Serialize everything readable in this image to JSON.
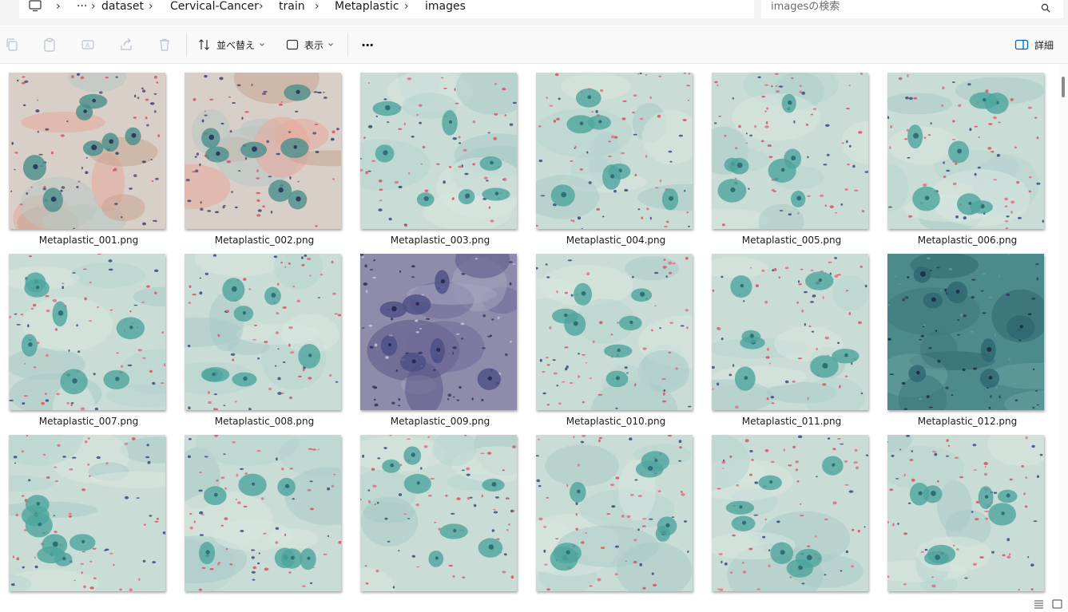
{
  "breadcrumb": {
    "items": [
      "dataset",
      "Cervical-Cancer",
      "train",
      "Metaplastic",
      "images"
    ],
    "overflow": "···"
  },
  "search": {
    "placeholder": "imagesの検索"
  },
  "toolbar": {
    "sort_label": "並べ替え",
    "view_label": "表示",
    "more": "···",
    "details_label": "詳細"
  },
  "files": [
    {
      "name": "Metaplastic_001.png",
      "palette": "pink"
    },
    {
      "name": "Metaplastic_002.png",
      "palette": "pink"
    },
    {
      "name": "Metaplastic_003.png",
      "palette": "light"
    },
    {
      "name": "Metaplastic_004.png",
      "palette": "light"
    },
    {
      "name": "Metaplastic_005.png",
      "palette": "light"
    },
    {
      "name": "Metaplastic_006.png",
      "palette": "light"
    },
    {
      "name": "Metaplastic_007.png",
      "palette": "light"
    },
    {
      "name": "Metaplastic_008.png",
      "palette": "light"
    },
    {
      "name": "Metaplastic_009.png",
      "palette": "purple"
    },
    {
      "name": "Metaplastic_010.png",
      "palette": "light"
    },
    {
      "name": "Metaplastic_011.png",
      "palette": "light"
    },
    {
      "name": "Metaplastic_012.png",
      "palette": "dark"
    },
    {
      "name": "",
      "palette": "light"
    },
    {
      "name": "",
      "palette": "light"
    },
    {
      "name": "",
      "palette": "light"
    },
    {
      "name": "",
      "palette": "light"
    },
    {
      "name": "",
      "palette": "light"
    },
    {
      "name": "",
      "palette": "light"
    }
  ],
  "colors": {
    "accent": "#0067c0",
    "toolbar_bg": "#f9f9f9",
    "address_bg": "#f3f3f3"
  }
}
